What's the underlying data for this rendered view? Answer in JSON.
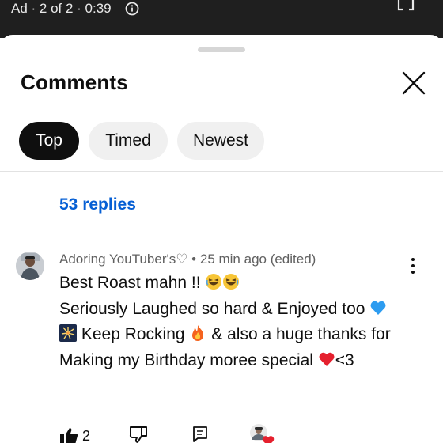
{
  "player": {
    "ad_label": "Ad · 2 of 2 · 0:39"
  },
  "comments_panel": {
    "title": "Comments",
    "filters": [
      {
        "label": "Top",
        "selected": true
      },
      {
        "label": "Timed",
        "selected": false
      },
      {
        "label": "Newest",
        "selected": false
      }
    ],
    "replies_link": "53 replies"
  },
  "comment": {
    "author_meta": "Adoring YouTuber's♡ • 25 min ago (edited)",
    "lines": [
      "Best Roast mahn !! ",
      "Seriously Laughed so hard & Enjoyed too ",
      " Keep Rocking ",
      " & also a huge thanks for",
      "Making my Birthday moree special ",
      "<3"
    ],
    "likes": "2"
  },
  "colors": {
    "link_blue": "#065fd4",
    "chip_active_bg": "#0f0f0f",
    "chip_bg": "#f0f0f0",
    "meta_gray": "#606060",
    "heart_red": "#e5202e"
  },
  "icons": {
    "info": "info-icon",
    "fullscreen": "fullscreen-icon",
    "close": "close-icon",
    "more": "more-vert-icon",
    "like": "thumb-up-icon",
    "dislike": "thumb-down-icon",
    "reply": "reply-comment-icon",
    "creator_heart": "creator-heart-icon"
  }
}
